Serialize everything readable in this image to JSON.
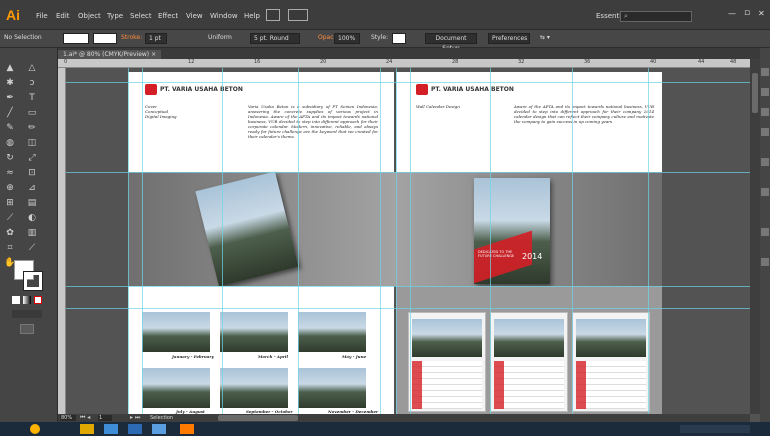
{
  "app": {
    "logo": "Ai"
  },
  "menu": [
    "File",
    "Edit",
    "Object",
    "Type",
    "Select",
    "Effect",
    "View",
    "Window",
    "Help"
  ],
  "workspace": {
    "label": "Essentials"
  },
  "window_controls": {
    "minimize": "—",
    "restore": "▫",
    "close": "✕"
  },
  "control_bar": {
    "selection": "No Selection",
    "stroke_label": "Stroke:",
    "stroke_weight": "1 pt",
    "profile": "Uniform",
    "brush": "5 pt. Round",
    "opacity_label": "Opacity:",
    "opacity_value": "100%",
    "style_label": "Style:",
    "document_setup": "Document Setup",
    "preferences": "Preferences"
  },
  "doc_tab": {
    "title": "1.ai* @ 80% (CMYK/Preview)",
    "close": "×"
  },
  "rulers": {
    "marks": [
      "0",
      "12",
      "16",
      "20",
      "24",
      "28",
      "32",
      "36",
      "40",
      "44",
      "48"
    ]
  },
  "artboards": {
    "company": "PT. VARIA USAHA BETON",
    "left_labels": [
      "Cover",
      "Conceptual",
      "Digital Imaging"
    ],
    "left_body": "Varia Usaha Beton is a subsidiary of PT Semen Indonesia, answering the concrete supplies of various project in Indonesia. Aware of the AFTA and its impact towards national business, VUB decided to step into different approach for their corporate calendar. Modern, innovative, reliable, and always ready for future challenge are the keyword that we created for their calendar's theme.",
    "right_labels": [
      "Wall Calendar Design"
    ],
    "right_body": "Aware of the AFTA and its impact towards national business, VUB decided to step into different approach for their company 2014 calendar design that can reflect their company culture and motivate the company to gain success in up coming years",
    "cover_year": "2014",
    "cover_tagline": "DEDICATED TO THE FUTURE CHALLENGE",
    "photo_captions": [
      "January - February",
      "March - April",
      "May - June",
      "July - August",
      "September - October",
      "November - December"
    ]
  },
  "status": {
    "zoom": "80%",
    "page": "1",
    "tool": "Selection"
  }
}
